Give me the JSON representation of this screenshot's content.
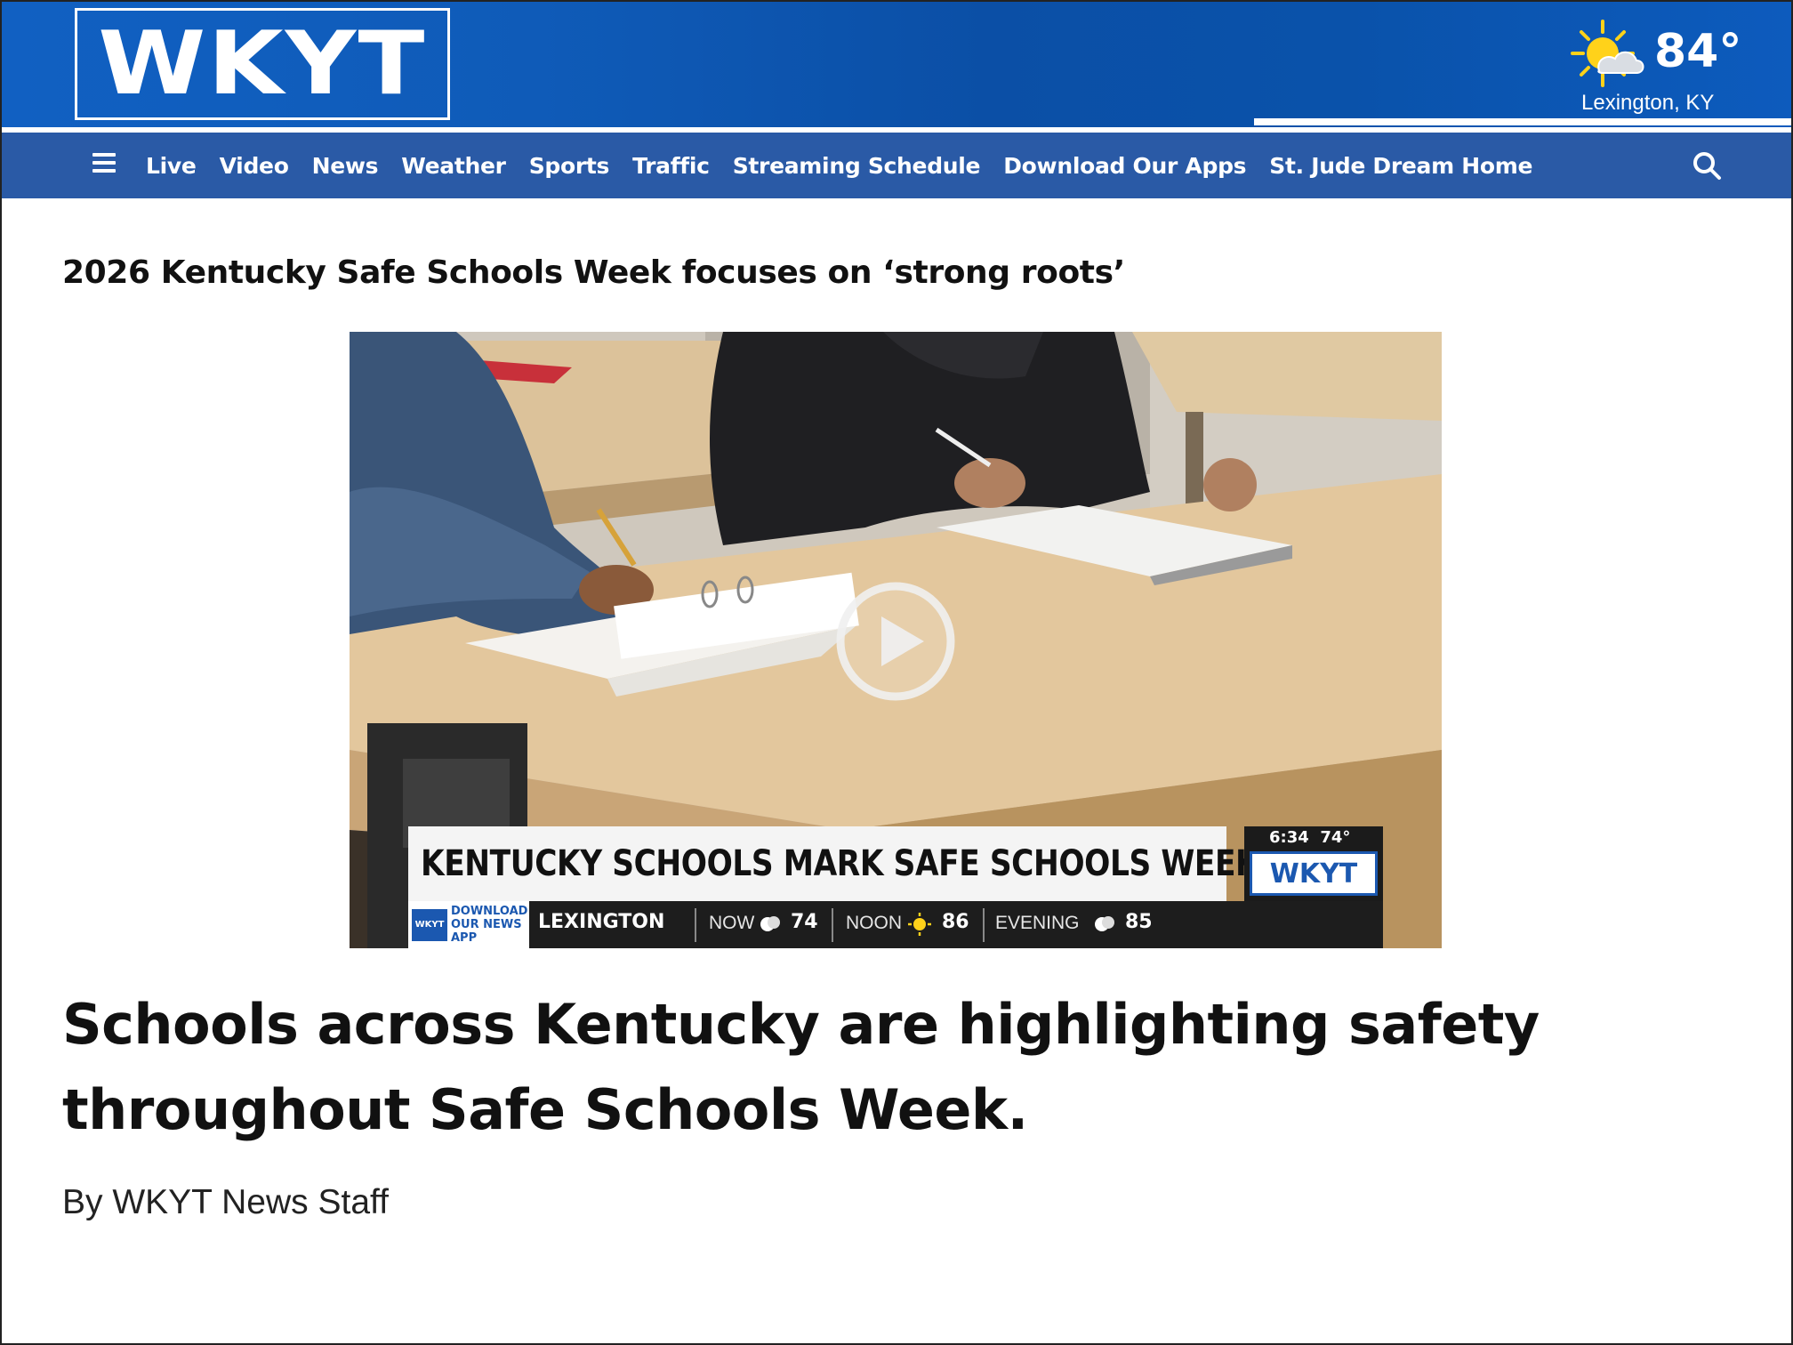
{
  "header": {
    "logo_text": "WKYT",
    "weather": {
      "temperature": "84°",
      "location": "Lexington, KY",
      "icon": "partly-sunny-icon"
    }
  },
  "nav": {
    "menu_icon": "hamburger-menu-icon",
    "items": [
      {
        "label": "Live"
      },
      {
        "label": "Video"
      },
      {
        "label": "News"
      },
      {
        "label": "Weather"
      },
      {
        "label": "Sports"
      },
      {
        "label": "Traffic"
      },
      {
        "label": "Streaming Schedule"
      },
      {
        "label": "Download Our Apps"
      },
      {
        "label": "St. Jude Dream Home"
      }
    ],
    "search_icon": "search-icon"
  },
  "article": {
    "kicker": "2026 Kentucky Safe Schools Week focuses on ‘strong roots’",
    "headline": "Schools across Kentucky are highlighting safety throughout Safe Schools Week.",
    "byline": "By WKYT News Staff"
  },
  "video": {
    "play_icon": "play-icon",
    "lower_third": "KENTUCKY SCHOOLS MARK SAFE SCHOOLS WEEK",
    "bug_time": "6:34",
    "bug_temp": "74°",
    "bug_logo": "WKYT",
    "ticker": {
      "app_logo": "WKYT",
      "app_text": "DOWNLOAD OUR NEWS APP",
      "city": "LEXINGTON",
      "now_label": "NOW",
      "now_value": "74",
      "noon_label": "NOON",
      "noon_value": "86",
      "evening_label": "EVENING",
      "evening_value": "85"
    }
  },
  "colors": {
    "header_blue": "#0f5bb8",
    "nav_blue": "#2a5aa6",
    "text": "#111111"
  }
}
